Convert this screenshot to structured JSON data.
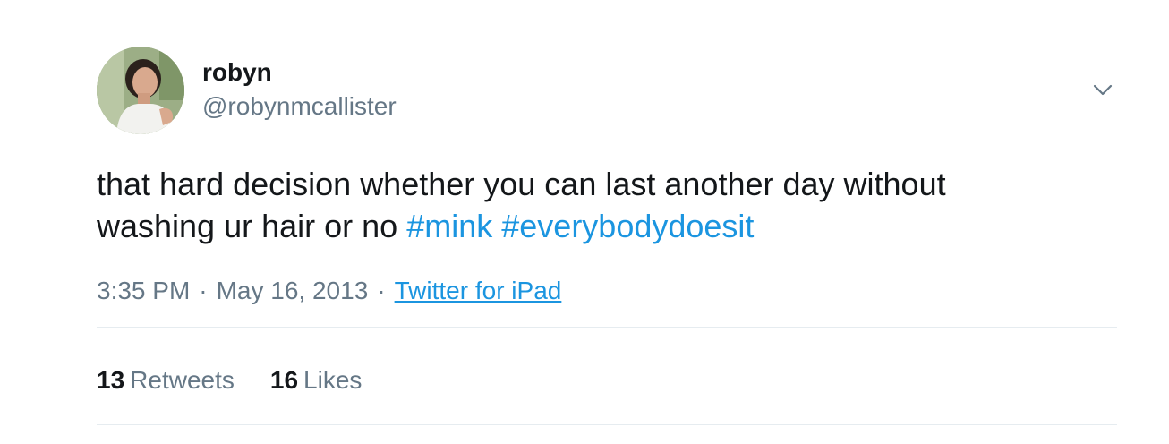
{
  "tweet": {
    "author": {
      "display_name": "robyn",
      "handle": "@robynmcallister",
      "avatar_icon": "user-photo-avatar"
    },
    "menu_icon": "chevron-down-icon",
    "text": {
      "line1": "that hard decision whether you can last another day without",
      "line2_prefix": "washing ur hair or no",
      "hashtags": [
        "#mink",
        "#everybodydoesit"
      ]
    },
    "meta": {
      "time": "3:35 PM",
      "separator": "·",
      "date": "May 16, 2013",
      "source": "Twitter for iPad"
    },
    "stats": {
      "retweets_count": "13",
      "retweets_label": "Retweets",
      "likes_count": "16",
      "likes_label": "Likes"
    },
    "colors": {
      "link": "#1b95e0",
      "secondary_text": "#657786",
      "primary_text": "#14171a",
      "divider": "#e6ecf0"
    }
  }
}
